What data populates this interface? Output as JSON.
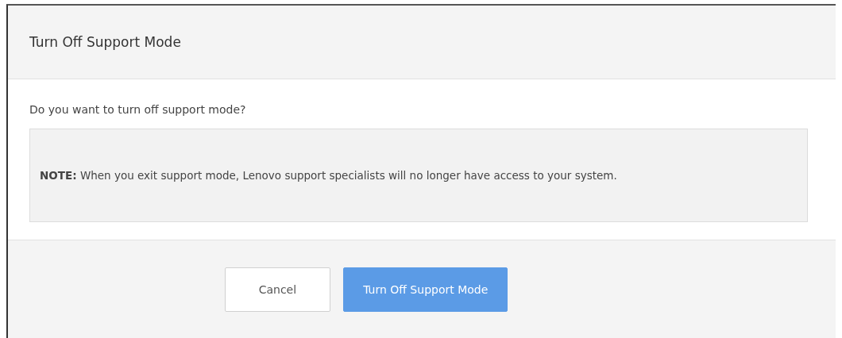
{
  "dialog": {
    "title": "Turn Off Support Mode",
    "question": "Do you want to turn off support mode?",
    "note": "**NOTE:** When you exit support mode, Lenovo support specialists will no longer have access to your system.",
    "buttons": [
      {
        "label": "Cancel",
        "kind": "secondary"
      },
      {
        "label": "Turn Off Support Mode",
        "kind": "primary"
      }
    ]
  }
}
